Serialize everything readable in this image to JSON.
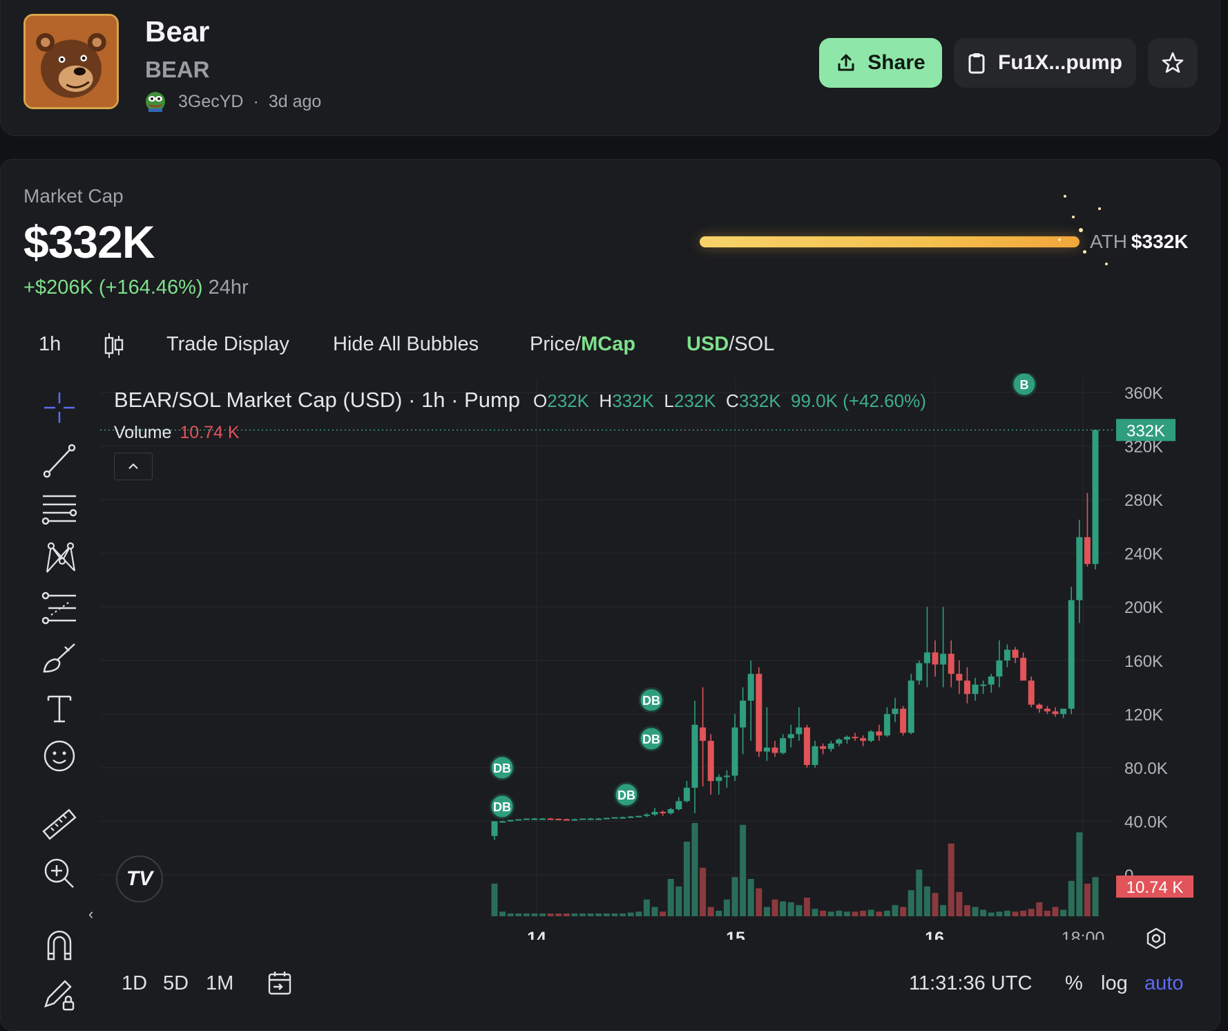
{
  "header": {
    "token_name": "Bear",
    "ticker": "BEAR",
    "creator": "3GecYD",
    "separator": "·",
    "age": "3d ago",
    "share_label": "Share",
    "address_label": "Fu1X...pump",
    "share_color": "#8ee6a8"
  },
  "market": {
    "label": "Market Cap",
    "value": "$332K",
    "change": "+$206K (+164.46%)",
    "change_period": "24hr",
    "ath_label": "ATH",
    "ath_value": "$332K",
    "ath_progress": 1.0
  },
  "toolbar": {
    "interval": "1h",
    "trade_display": "Trade Display",
    "hide_bubbles": "Hide All Bubbles",
    "price_part": "Price/",
    "mcap_part": "MCap",
    "usd_part": "USD",
    "sol_part": "/SOL"
  },
  "left_tools": [
    "crosshair-icon",
    "trend-line-icon",
    "horizontal-lines-icon",
    "pattern-icon",
    "fib-levels-icon",
    "brush-icon",
    "text-icon",
    "emoji-icon",
    "ruler-icon",
    "zoom-in-icon",
    "magnet-icon",
    "lock-pencil-icon"
  ],
  "legend": {
    "title": "BEAR/SOL Market Cap (USD) · 1h · Pump",
    "o_key": "O",
    "o_val": "232K",
    "h_key": "H",
    "h_val": "332K",
    "l_key": "L",
    "l_val": "232K",
    "c_key": "C",
    "c_val": "332K",
    "change": "99.0K (+42.60%)",
    "volume_label": "Volume",
    "volume_value": "10.74 K"
  },
  "chart_data": {
    "type": "candlestick",
    "title": "BEAR/SOL Market Cap (USD) · 1h · Pump",
    "y_ticks": [
      "360K",
      "320K",
      "280K",
      "240K",
      "200K",
      "160K",
      "120K",
      "80.0K",
      "40.0K",
      "0"
    ],
    "y_tick_values": [
      360000,
      320000,
      280000,
      240000,
      200000,
      160000,
      120000,
      80000,
      40000,
      0
    ],
    "ylim": [
      0,
      360000
    ],
    "x_ticks": [
      "14",
      "15",
      "16",
      "18:00"
    ],
    "last_price_label": "332K",
    "last_price": 332000,
    "volume_label": "10.74 K",
    "up_color": "#2f9e7e",
    "down_color": "#e0545a",
    "bubbles": [
      {
        "label": "DB",
        "time": "14 ~04:00",
        "price": 67000
      },
      {
        "label": "DB",
        "time": "14 ~04:00",
        "price": 38000
      },
      {
        "label": "DB",
        "time": "14 ~17:00",
        "price": 43000
      },
      {
        "label": "DB",
        "time": "14 ~18:00",
        "price": 100000
      },
      {
        "label": "DB",
        "time": "14 ~18:00",
        "price": 71000
      },
      {
        "label": "B",
        "time": "16 ~11:00",
        "price": 365000
      }
    ]
  },
  "bottom": {
    "range_1d": "1D",
    "range_5d": "5D",
    "range_1m": "1M",
    "time": "11:31:36 UTC",
    "percent": "%",
    "log": "log",
    "auto": "auto"
  }
}
